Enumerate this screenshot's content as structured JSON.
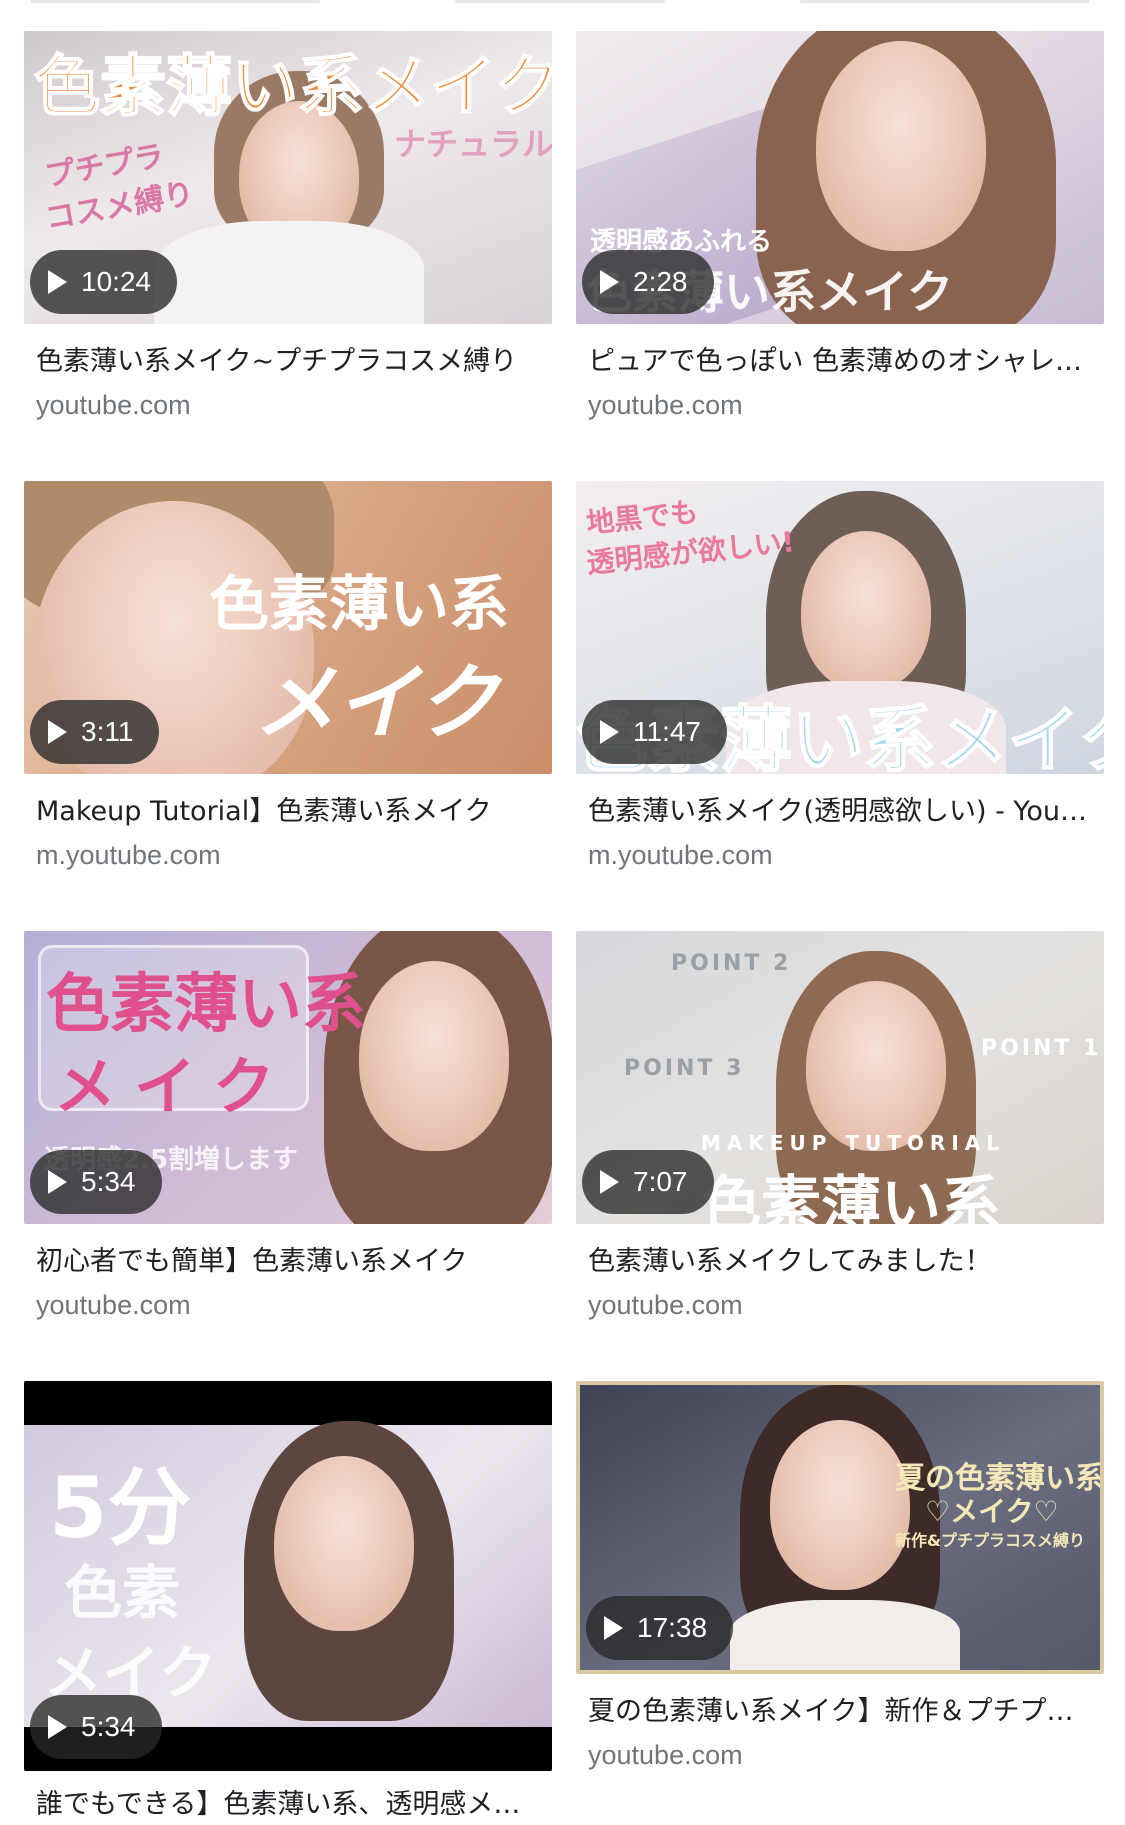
{
  "results": [
    {
      "duration": "10:24",
      "title": "色素薄い系メイク~プチプラコスメ縛り",
      "domain": "youtube.com",
      "overlay": {
        "main": "色素薄い系メイク",
        "sub1": "プチプラ",
        "sub2": "コスメ縛り",
        "sub3": "ナチュラル"
      },
      "colors": {
        "bg1": "#d9d4d8",
        "bg2": "#efe9ec",
        "main": "#f08a3c"
      }
    },
    {
      "duration": "2:28",
      "title": "ピュアで色っぽい 色素薄めのオシャレメイク",
      "domain": "youtube.com",
      "overlay": {
        "main": "色素薄い系メイク",
        "sub1": "透明感あふれる"
      },
      "colors": {
        "bg1": "#cbc3d6",
        "bg2": "#efe7ea",
        "main": "#ffffff"
      }
    },
    {
      "duration": "3:11",
      "title": "Makeup Tutorial】色素薄い系メイク",
      "domain": "m.youtube.com",
      "overlay": {
        "main": "色素薄い系",
        "sub1": "メイク"
      },
      "colors": {
        "bg1": "#d2a07f",
        "bg2": "#e8c4a8",
        "main": "#ffffff"
      }
    },
    {
      "duration": "11:47",
      "title": "色素薄い系メイク(透明感欲しい) - YouTube",
      "domain": "m.youtube.com",
      "overlay": {
        "main": "色素薄い系メイク",
        "sub1": "地黒でも",
        "sub2": "透明感が欲しい!"
      },
      "colors": {
        "bg1": "#dfe3ea",
        "bg2": "#f3eef1",
        "main": "#a9d7ee"
      }
    },
    {
      "duration": "5:34",
      "title": "初心者でも簡単】色素薄い系メイク",
      "domain": "youtube.com",
      "overlay": {
        "main": "色素薄い系",
        "sub1": "メイク",
        "sub2": "透明感2.5割増します"
      },
      "colors": {
        "bg1": "#b9b2d6",
        "bg2": "#dcc9d8",
        "main": "#e0508d"
      }
    },
    {
      "duration": "7:07",
      "title": "色素薄い系メイクしてみました！",
      "domain": "youtube.com",
      "overlay": {
        "main": "色素薄い系",
        "sub1": "POINT 2",
        "sub2": "POINT 3",
        "sub3": "POINT 1",
        "sub4": "MAKEUP TUTORIAL"
      },
      "colors": {
        "bg1": "#cfd2d6",
        "bg2": "#e8e6e4",
        "main": "#ffffff"
      }
    },
    {
      "duration": "5:34",
      "title": "誰でもできる】色素薄い系、透明感メイク",
      "domain": "youtube.com",
      "overlay": {
        "main": "5分",
        "sub1": "色素",
        "sub2": "メイク"
      },
      "colors": {
        "bg1": "#c9c0d6",
        "bg2": "#ece7ef",
        "main": "#ffffff"
      }
    },
    {
      "duration": "17:38",
      "title": "夏の色素薄い系メイク】新作＆プチプラコスメ縛り",
      "domain": "youtube.com",
      "overlay": {
        "main": "夏の色素薄い系",
        "sub1": "♡メイク♡",
        "sub2": "新作&プチプラコスメ縛り"
      },
      "colors": {
        "bg1": "#4a4d5e",
        "bg2": "#7b7f93",
        "main": "#f4e7b8"
      }
    }
  ]
}
